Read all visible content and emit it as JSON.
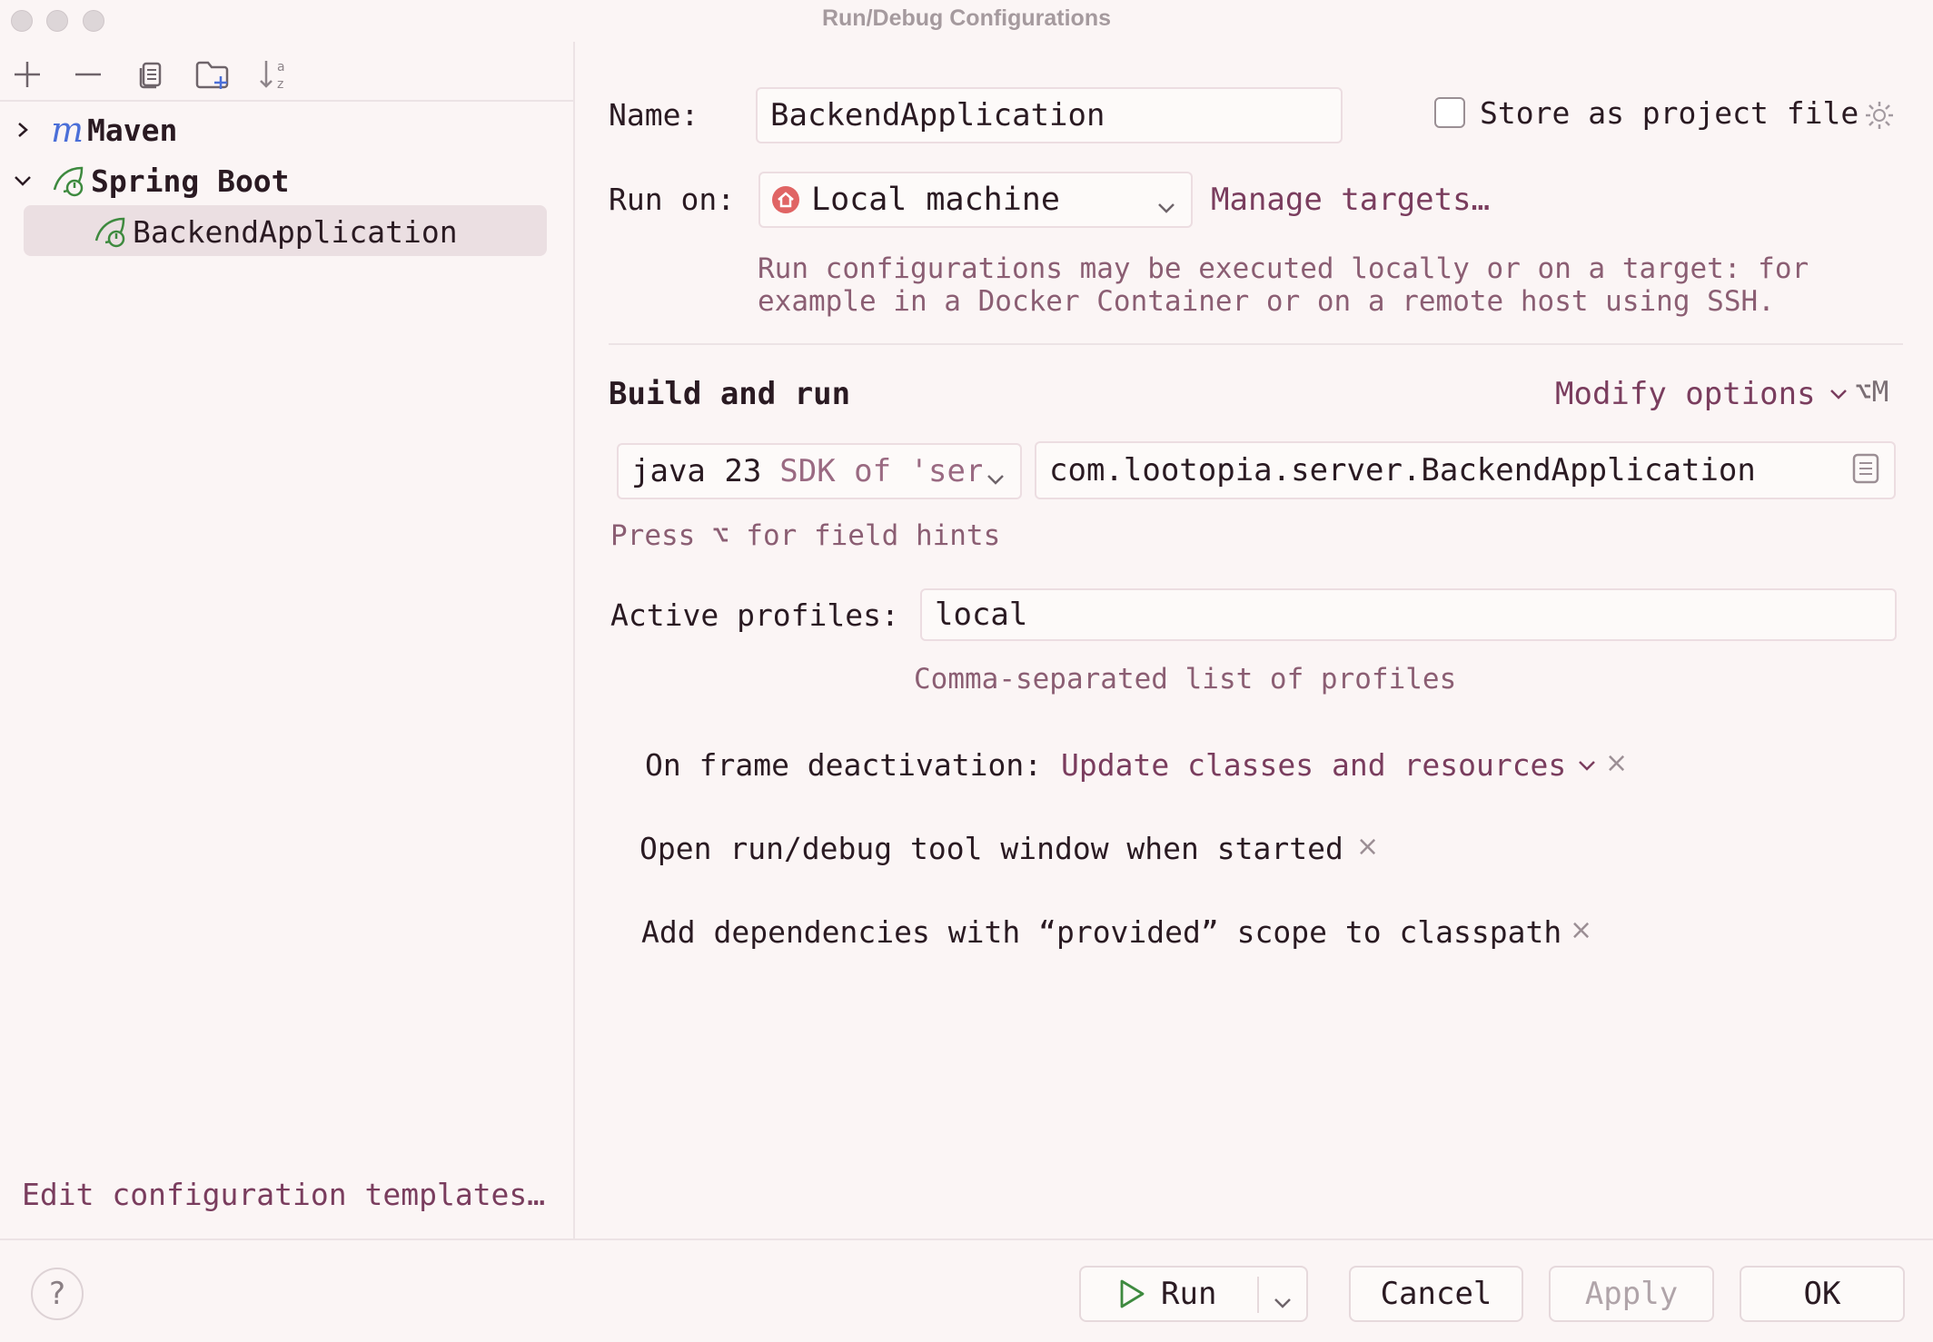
{
  "window": {
    "title": "Run/Debug Configurations"
  },
  "toolbar": {
    "icons": [
      "add-icon",
      "remove-icon",
      "copy-icon",
      "new-folder-icon",
      "sort-icon"
    ]
  },
  "tree": {
    "items": [
      {
        "label": "Maven",
        "expanded": false,
        "icon": "maven-icon"
      },
      {
        "label": "Spring Boot",
        "expanded": true,
        "icon": "spring-boot-icon"
      },
      {
        "label": "BackendApplication",
        "selected": true,
        "icon": "spring-boot-icon"
      }
    ]
  },
  "left_footer": {
    "edit_templates_link": "Edit configuration templates…"
  },
  "form": {
    "name_label": "Name:",
    "name_value": "BackendApplication",
    "store_as_project_file_label": "Store as project file",
    "store_as_project_file_checked": false,
    "run_on_label": "Run on:",
    "run_on_value": "Local machine",
    "manage_targets_link": "Manage targets…",
    "run_on_hint_line1": "Run configurations may be executed locally or on a target: for",
    "run_on_hint_line2": "example in a Docker Container or on a remote host using SSH.",
    "build_and_run_title": "Build and run",
    "modify_options_link": "Modify options",
    "modify_options_shortcut": "⌥M",
    "sdk_version": "java 23",
    "sdk_suffix": "SDK of 'serv",
    "main_class_value": "com.lootopia.server.BackendApplication",
    "field_hint": "Press ⌥ for field hints",
    "active_profiles_label": "Active profiles:",
    "active_profiles_value": "local",
    "active_profiles_hint": "Comma-separated list of profiles",
    "frame_deactivation_label": "On frame deactivation:",
    "frame_deactivation_value": "Update classes and resources",
    "open_tool_window_option": "Open run/debug tool window when started",
    "add_dependencies_option": "Add dependencies with “provided” scope to classpath"
  },
  "buttons": {
    "help_label": "?",
    "run_label": "Run",
    "cancel_label": "Cancel",
    "apply_label": "Apply",
    "ok_label": "OK"
  },
  "colors": {
    "accent_link": "#7a3d5e",
    "background": "#fbf5f5",
    "spring_green": "#3e8a3f",
    "maven_blue": "#4b6fd8",
    "local_machine_red": "#e06464"
  }
}
